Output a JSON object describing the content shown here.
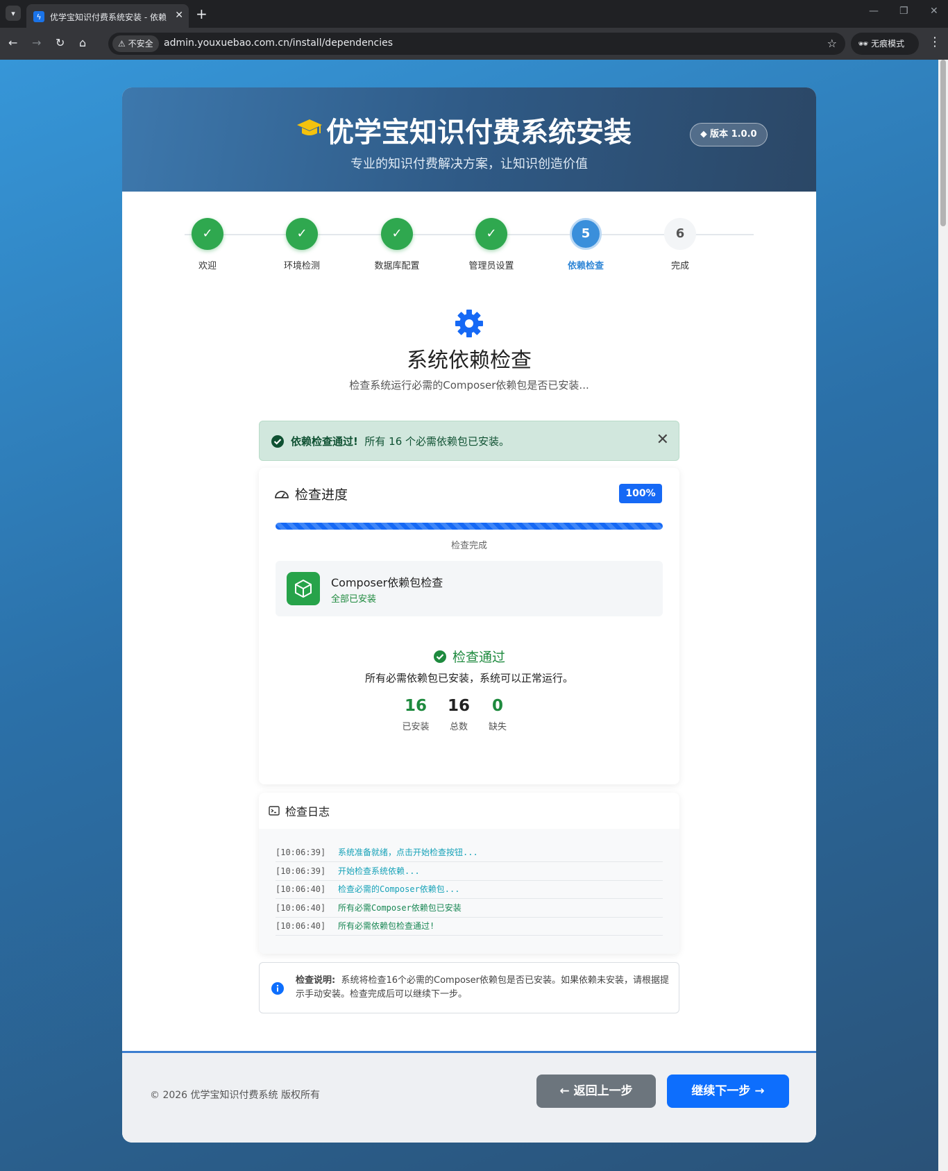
{
  "browser": {
    "tab_title": "优学宝知识付费系统安装 - 依赖",
    "insecure_label": "不安全",
    "url": "admin.youxuebao.com.cn/install/dependencies",
    "incognito_label": "无痕模式"
  },
  "header": {
    "title": "优学宝知识付费系统安装",
    "subtitle": "专业的知识付费解决方案，让知识创造价值",
    "version": "版本 1.0.0"
  },
  "steps": [
    {
      "label": "欢迎",
      "marker": "✓",
      "state": "done"
    },
    {
      "label": "环境检测",
      "marker": "✓",
      "state": "done"
    },
    {
      "label": "数据库配置",
      "marker": "✓",
      "state": "done"
    },
    {
      "label": "管理员设置",
      "marker": "✓",
      "state": "done"
    },
    {
      "label": "依赖检查",
      "marker": "5",
      "state": "active"
    },
    {
      "label": "完成",
      "marker": "6",
      "state": "pending"
    }
  ],
  "section": {
    "title": "系统依赖检查",
    "subtitle": "检查系统运行必需的Composer依赖包是否已安装..."
  },
  "alert": {
    "strong": "依赖检查通过!",
    "text": "所有 16 个必需依赖包已安装。"
  },
  "progress": {
    "title": "检查进度",
    "percent": "100%",
    "status": "检查完成",
    "item_title": "Composer依赖包检查",
    "item_status": "全部已安装",
    "pass_title": "检查通过",
    "pass_desc": "所有必需依赖包已安装，系统可以正常运行。",
    "stats": [
      {
        "value": "16",
        "label": "已安装",
        "color": "#1e8a3e"
      },
      {
        "value": "16",
        "label": "总数",
        "color": "#222222"
      },
      {
        "value": "0",
        "label": "缺失",
        "color": "#1e8a3e"
      }
    ]
  },
  "log": {
    "title": "检查日志",
    "lines": [
      {
        "time": "[10:06:39]",
        "msg": "系统准备就绪，点击开始检查按钮...",
        "type": "info"
      },
      {
        "time": "[10:06:39]",
        "msg": "开始检查系统依赖...",
        "type": "info"
      },
      {
        "time": "[10:06:40]",
        "msg": "检查必需的Composer依赖包...",
        "type": "info"
      },
      {
        "time": "[10:06:40]",
        "msg": "所有必需Composer依赖包已安装",
        "type": "ok"
      },
      {
        "time": "[10:06:40]",
        "msg": "所有必需依赖包检查通过!",
        "type": "ok"
      }
    ]
  },
  "note": {
    "label": "检查说明:",
    "text": "系统将检查16个必需的Composer依赖包是否已安装。如果依赖未安装，请根据提示手动安装。检查完成后可以继续下一步。"
  },
  "footer": {
    "copyright": "© 2026 优学宝知识付费系统 版权所有",
    "back_label": "返回上一步",
    "next_label": "继续下一步"
  },
  "colors": {
    "accent": "#0d6efd",
    "success": "#2fa84f",
    "active_step": "#3a8fdb"
  }
}
